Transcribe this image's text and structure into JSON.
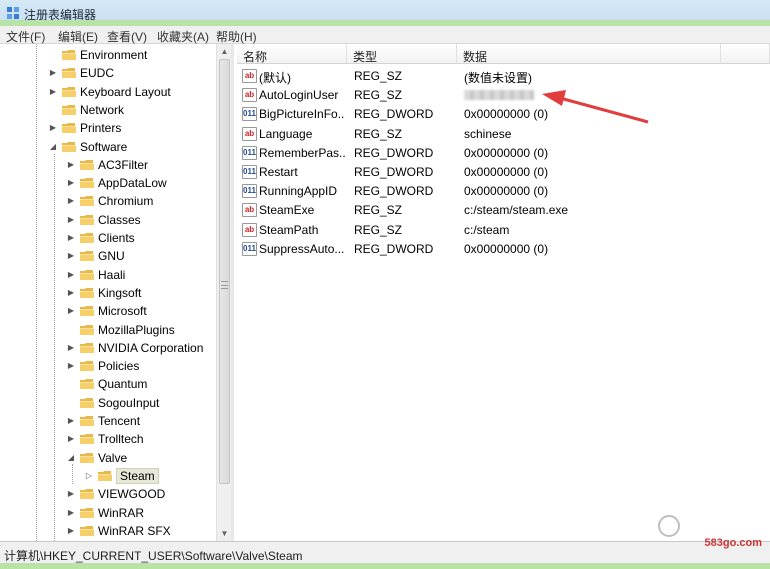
{
  "window": {
    "title": "注册表编辑器",
    "accent": "#b8e3a6"
  },
  "menu": [
    {
      "label": "文件(F)"
    },
    {
      "label": "编辑(E)"
    },
    {
      "label": "查看(V)"
    },
    {
      "label": "收藏夹(A)"
    },
    {
      "label": "帮助(H)"
    }
  ],
  "tree": {
    "items": [
      {
        "label": "Environment",
        "level": 1,
        "expander": "",
        "selected": false
      },
      {
        "label": "EUDC",
        "level": 1,
        "expander": "▶",
        "selected": false
      },
      {
        "label": "Keyboard Layout",
        "level": 1,
        "expander": "▶",
        "selected": false
      },
      {
        "label": "Network",
        "level": 1,
        "expander": "",
        "selected": false
      },
      {
        "label": "Printers",
        "level": 1,
        "expander": "▶",
        "selected": false
      },
      {
        "label": "Software",
        "level": 1,
        "expander": "◢",
        "selected": false
      },
      {
        "label": "AC3Filter",
        "level": 2,
        "expander": "▶",
        "selected": false
      },
      {
        "label": "AppDataLow",
        "level": 2,
        "expander": "▶",
        "selected": false
      },
      {
        "label": "Chromium",
        "level": 2,
        "expander": "▶",
        "selected": false
      },
      {
        "label": "Classes",
        "level": 2,
        "expander": "▶",
        "selected": false
      },
      {
        "label": "Clients",
        "level": 2,
        "expander": "▶",
        "selected": false
      },
      {
        "label": "GNU",
        "level": 2,
        "expander": "▶",
        "selected": false
      },
      {
        "label": "Haali",
        "level": 2,
        "expander": "▶",
        "selected": false
      },
      {
        "label": "Kingsoft",
        "level": 2,
        "expander": "▶",
        "selected": false
      },
      {
        "label": "Microsoft",
        "level": 2,
        "expander": "▶",
        "selected": false
      },
      {
        "label": "MozillaPlugins",
        "level": 2,
        "expander": "",
        "selected": false
      },
      {
        "label": "NVIDIA Corporation",
        "level": 2,
        "expander": "▶",
        "selected": false
      },
      {
        "label": "Policies",
        "level": 2,
        "expander": "▶",
        "selected": false
      },
      {
        "label": "Quantum",
        "level": 2,
        "expander": "",
        "selected": false
      },
      {
        "label": "SogouInput",
        "level": 2,
        "expander": "",
        "selected": false
      },
      {
        "label": "Tencent",
        "level": 2,
        "expander": "▶",
        "selected": false
      },
      {
        "label": "Trolltech",
        "level": 2,
        "expander": "▶",
        "selected": false
      },
      {
        "label": "Valve",
        "level": 2,
        "expander": "◢",
        "selected": false
      },
      {
        "label": "Steam",
        "level": 3,
        "expander": "▷",
        "selected": true
      },
      {
        "label": "VIEWGOOD",
        "level": 2,
        "expander": "▶",
        "selected": false
      },
      {
        "label": "WinRAR",
        "level": 2,
        "expander": "▶",
        "selected": false
      },
      {
        "label": "WinRAR SFX",
        "level": 2,
        "expander": "▶",
        "selected": false
      }
    ]
  },
  "columns": {
    "name": "名称",
    "type": "类型",
    "data": "数据"
  },
  "values": [
    {
      "icon": "ab",
      "kind": "sz",
      "name": "(默认)",
      "type": "REG_SZ",
      "data": "(数值未设置)",
      "redacted": false
    },
    {
      "icon": "ab",
      "kind": "sz",
      "name": "AutoLoginUser",
      "type": "REG_SZ",
      "data": "",
      "redacted": true
    },
    {
      "icon": "011",
      "kind": "dword",
      "name": "BigPictureInFo...",
      "type": "REG_DWORD",
      "data": "0x00000000 (0)",
      "redacted": false
    },
    {
      "icon": "ab",
      "kind": "sz",
      "name": "Language",
      "type": "REG_SZ",
      "data": "schinese",
      "redacted": false
    },
    {
      "icon": "011",
      "kind": "dword",
      "name": "RememberPas...",
      "type": "REG_DWORD",
      "data": "0x00000000 (0)",
      "redacted": false
    },
    {
      "icon": "011",
      "kind": "dword",
      "name": "Restart",
      "type": "REG_DWORD",
      "data": "0x00000000 (0)",
      "redacted": false
    },
    {
      "icon": "011",
      "kind": "dword",
      "name": "RunningAppID",
      "type": "REG_DWORD",
      "data": "0x00000000 (0)",
      "redacted": false
    },
    {
      "icon": "ab",
      "kind": "sz",
      "name": "SteamExe",
      "type": "REG_SZ",
      "data": "c:/steam/steam.exe",
      "redacted": false
    },
    {
      "icon": "ab",
      "kind": "sz",
      "name": "SteamPath",
      "type": "REG_SZ",
      "data": "c:/steam",
      "redacted": false
    },
    {
      "icon": "011",
      "kind": "dword",
      "name": "SuppressAuto...",
      "type": "REG_DWORD",
      "data": "0x00000000 (0)",
      "redacted": false
    }
  ],
  "statusbar": {
    "path": "计算机\\HKEY_CURRENT_USER\\Software\\Valve\\Steam"
  },
  "watermark": {
    "text": "583go.com"
  },
  "annotation": {
    "arrow_color": "#e23c3c"
  }
}
